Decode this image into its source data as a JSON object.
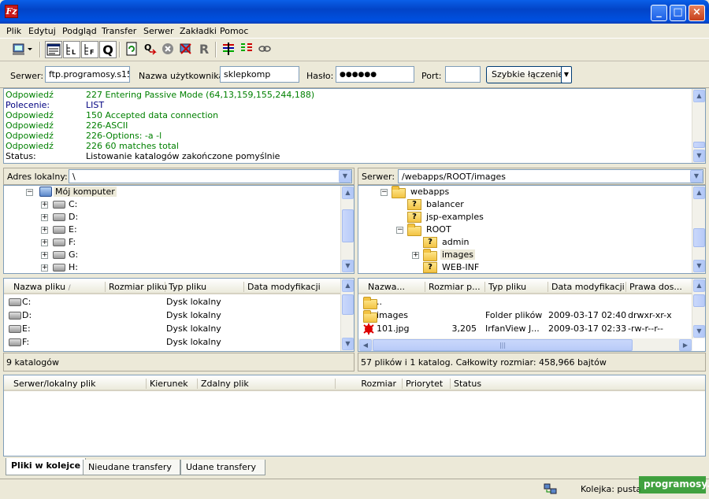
{
  "window": {
    "app_icon_letter": "Fz",
    "minimize": "_",
    "maximize": "□",
    "close": "×"
  },
  "menu": [
    "Plik",
    "Edytuj",
    "Podgląd",
    "Transfer",
    "Serwer",
    "Zakładki",
    "Pomoc"
  ],
  "quickconnect": {
    "server_label": "Serwer:",
    "server_value": "ftp.programosy.s15",
    "user_label": "Nazwa użytkownika:",
    "user_value": "sklepkomp",
    "pass_label": "Hasło:",
    "pass_value": "●●●●●●",
    "port_label": "Port:",
    "port_value": "",
    "connect_label": "Szybkie łączenie"
  },
  "log": [
    {
      "label": "Odpowiedź",
      "msg": "227 Entering Passive Mode (64,13,159,155,244,188)",
      "color": "#008000"
    },
    {
      "label": "Polecenie:",
      "msg": "LIST",
      "color": "#000080"
    },
    {
      "label": "Odpowiedź",
      "msg": "150 Accepted data connection",
      "color": "#008000"
    },
    {
      "label": "Odpowiedź",
      "msg": "226-ASCII",
      "color": "#008000"
    },
    {
      "label": "Odpowiedź",
      "msg": "226-Options: -a -l",
      "color": "#008000"
    },
    {
      "label": "Odpowiedź",
      "msg": "226 60 matches total",
      "color": "#008000"
    },
    {
      "label": "Status:",
      "msg": "Listowanie katalogów zakończone pomyślnie",
      "color": "#000000"
    }
  ],
  "local": {
    "path_label": "Adres lokalny:",
    "path_value": "\\",
    "tree": {
      "root": "Mój komputer",
      "drives": [
        "C:",
        "D:",
        "E:",
        "F:",
        "G:",
        "H:"
      ]
    },
    "columns": [
      "Nazwa pliku",
      "Rozmiar pliku",
      "Typ pliku",
      "Data modyfikacji"
    ],
    "files": [
      {
        "name": "C:",
        "type": "Dysk lokalny"
      },
      {
        "name": "D:",
        "type": "Dysk lokalny"
      },
      {
        "name": "E:",
        "type": "Dysk lokalny"
      },
      {
        "name": "F:",
        "type": "Dysk lokalny"
      }
    ],
    "status": "9 katalogów"
  },
  "remote": {
    "path_label": "Serwer:",
    "path_value": "/webapps/ROOT/images",
    "tree": [
      {
        "label": "webapps",
        "kind": "folder",
        "indent": 0,
        "exp": "−"
      },
      {
        "label": "balancer",
        "kind": "qfolder",
        "indent": 1,
        "exp": ""
      },
      {
        "label": "jsp-examples",
        "kind": "qfolder",
        "indent": 1,
        "exp": ""
      },
      {
        "label": "ROOT",
        "kind": "folder",
        "indent": 1,
        "exp": "−"
      },
      {
        "label": "admin",
        "kind": "qfolder",
        "indent": 2,
        "exp": ""
      },
      {
        "label": "images",
        "kind": "folder",
        "indent": 2,
        "exp": "+"
      },
      {
        "label": "WEB-INF",
        "kind": "qfolder",
        "indent": 2,
        "exp": ""
      }
    ],
    "columns": [
      "Nazwa...",
      "Rozmiar p...",
      "Typ pliku",
      "Data modyfikacji",
      "Prawa dos..."
    ],
    "files": [
      {
        "name": "..",
        "size": "",
        "type": "",
        "date": "",
        "perm": ""
      },
      {
        "name": "images",
        "size": "",
        "type": "Folder plików",
        "date": "2009-03-17 02:40",
        "perm": "drwxr-xr-x"
      },
      {
        "name": "101.jpg",
        "size": "3,205",
        "type": "IrfanView J...",
        "date": "2009-03-17 02:33",
        "perm": "-rw-r--r--"
      }
    ],
    "status": "57 plików i 1 katalog. Całkowity rozmiar: 458,966 bajtów"
  },
  "queue": {
    "columns": [
      "Serwer/lokalny plik",
      "Kierunek",
      "Zdalny plik",
      "Rozmiar",
      "Priorytet",
      "Status"
    ]
  },
  "tabs": [
    "Pliki w kolejce",
    "Nieudane transfery",
    "Udane transfery"
  ],
  "statusbar": {
    "queue_text": "Kolejka: pusta"
  },
  "watermark": "programosy.pl"
}
